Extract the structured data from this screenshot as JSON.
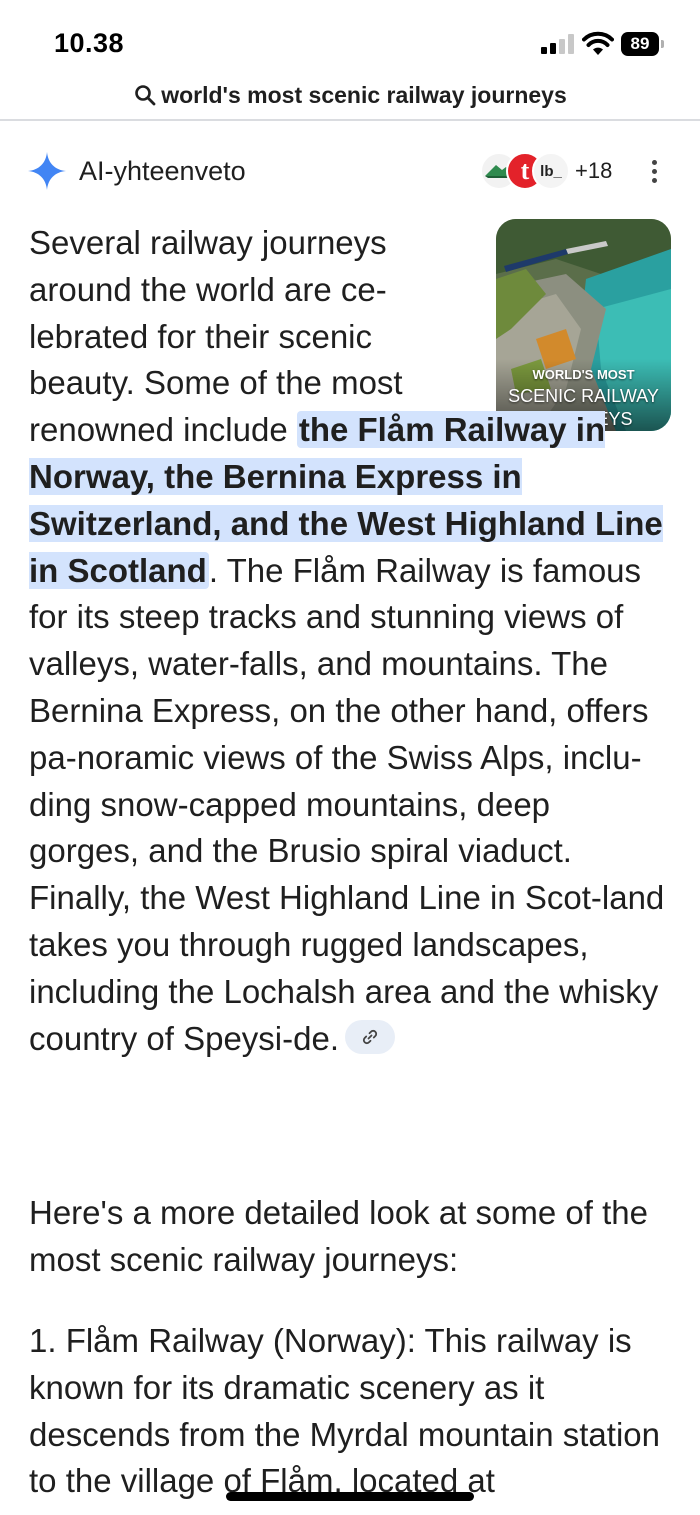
{
  "status_bar": {
    "time": "10.38",
    "battery": "89"
  },
  "search": {
    "query": "world's most scenic railway journeys"
  },
  "ai_overview": {
    "title": "AI-yhteenveto",
    "sources_more": "+18",
    "source_icons": [
      "mountain-logo",
      "t-logo",
      "lb-logo"
    ],
    "thumbnail": {
      "caption_top": "WORLD'S MOST",
      "caption_mid": "SCENIC RAILWAY",
      "caption_bottom": "JOURNEYS"
    },
    "intro_lines": [
      "Several railway journeys",
      "around the world are ce-",
      "lebrated for their scenic",
      "beauty. Some of the most",
      "renowned include "
    ],
    "highlight": "the Flåm Railway in Norway, the Bernina Express in Switzerland, and the West Highland Line in Scotland",
    "body": ". The Flåm Railway is famous for its steep tracks and stunning views of valleys, water-falls, and mountains. The Bernina Express, on the other hand, offers pa-noramic views of the Swiss Alps, inclu-ding snow-capped mountains, deep gorges, and the Brusio spiral viaduct. Finally, the West Highland Line in Scot-land takes you through rugged landscapes, including the Lochalsh area and the whisky country of Speysi-de.",
    "detail_intro": "Here's a more detailed look at some of the most scenic railway journeys:",
    "item_1": "1. Flåm Railway (Norway): This railway is known for its dramatic scenery as it descends from the Myrdal mountain station to the village of Flåm, located at"
  },
  "colors": {
    "highlight": "#d3e3fd",
    "sparkle": "#4285f4",
    "text": "#1f1f1f"
  }
}
